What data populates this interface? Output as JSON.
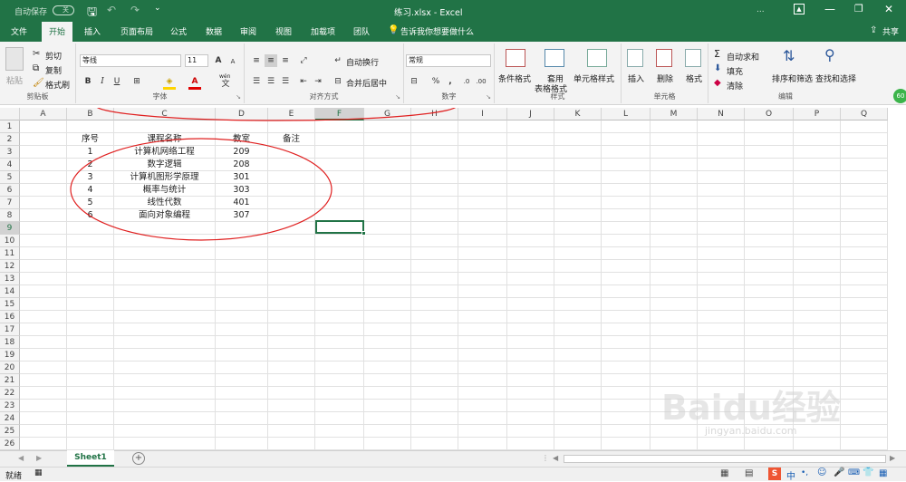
{
  "titlebar": {
    "autosave_label": "自动保存",
    "autosave_state": "关",
    "title": "练习.xlsx  -  Excel",
    "user_label": "...",
    "min_icon": "minimize-icon",
    "restore_icon": "restore-icon",
    "close_icon": "close-icon"
  },
  "tabs": {
    "items": [
      "文件",
      "开始",
      "插入",
      "页面布局",
      "公式",
      "数据",
      "审阅",
      "视图",
      "加载项",
      "团队"
    ],
    "active": "开始",
    "tellme": "告诉我你想要做什么",
    "share": "共享"
  },
  "ribbon": {
    "clipboard": {
      "paste": "粘贴",
      "cut": "剪切",
      "copy": "复制",
      "format_painter": "格式刷",
      "label": "剪贴板"
    },
    "font": {
      "name": "等线",
      "size": "11",
      "bold": "B",
      "italic": "I",
      "underline": "U",
      "grow": "A",
      "shrink": "A",
      "label": "字体",
      "wen": "wén"
    },
    "alignment": {
      "wrap": "自动换行",
      "merge": "合并后居中",
      "label": "对齐方式"
    },
    "number": {
      "format": "常规",
      "percent": "%",
      "comma": ",",
      "label": "数字"
    },
    "styles": {
      "conditional": "条件格式",
      "table_1": "套用",
      "table_2": "表格格式",
      "cell_styles": "单元格样式",
      "label": "样式"
    },
    "cells": {
      "insert": "插入",
      "delete": "删除",
      "format": "格式",
      "label": "单元格"
    },
    "editing": {
      "autosum": "自动求和",
      "fill": "填充",
      "clear": "清除",
      "sort": "排序和筛选",
      "find": "查找和选择",
      "label": "编辑"
    }
  },
  "grid": {
    "columns": [
      "A",
      "B",
      "C",
      "D",
      "E",
      "F",
      "G",
      "H",
      "I",
      "J",
      "K",
      "L",
      "M",
      "N",
      "O",
      "P",
      "Q"
    ],
    "rows": [
      "1",
      "2",
      "3",
      "4",
      "5",
      "6",
      "7",
      "8",
      "9",
      "10",
      "11",
      "12",
      "13",
      "14",
      "15",
      "16",
      "17",
      "18",
      "19",
      "20",
      "21",
      "22",
      "23",
      "24",
      "25",
      "26"
    ],
    "table": {
      "headers": [
        "序号",
        "课程名称",
        "教室",
        "备注"
      ],
      "data": [
        [
          "1",
          "计算机网络工程",
          "209",
          ""
        ],
        [
          "2",
          "数字逻辑",
          "208",
          ""
        ],
        [
          "3",
          "计算机图形学原理",
          "301",
          ""
        ],
        [
          "4",
          "概率与统计",
          "303",
          ""
        ],
        [
          "5",
          "线性代数",
          "401",
          ""
        ],
        [
          "6",
          "面向对象编程",
          "307",
          ""
        ]
      ]
    },
    "selected_cell": "F9",
    "annotation_color": "#e02020"
  },
  "sheetbar": {
    "sheet_name": "Sheet1",
    "add_label": "+"
  },
  "statusbar": {
    "ready": "就绪",
    "ime": "中",
    "watermark": "Baidu经验",
    "watermark_url": "jingyan.baidu.com"
  }
}
